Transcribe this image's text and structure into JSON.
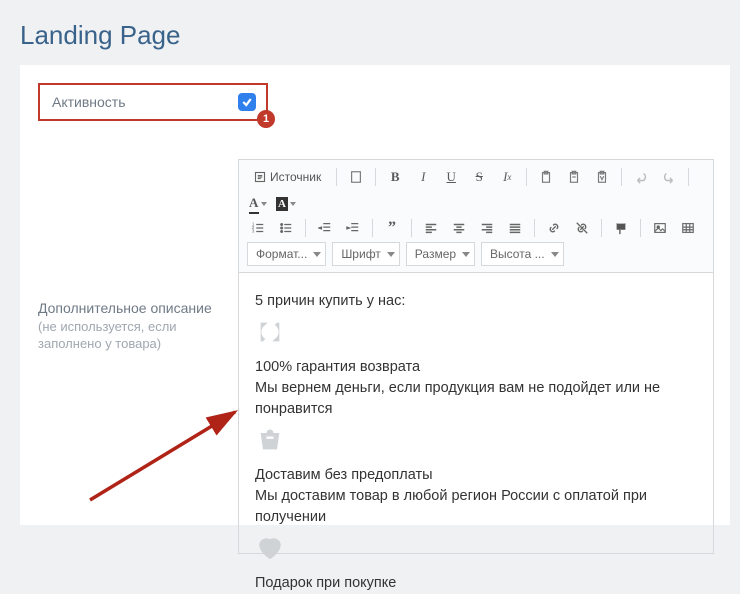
{
  "page_title": "Landing Page",
  "activity": {
    "label": "Активность",
    "checked": true,
    "badge": "1"
  },
  "description_field": {
    "label": "Дополнительное описание",
    "hint": "(не используется, если заполнено у товара)"
  },
  "toolbar": {
    "source": "Источник",
    "format": "Формат...",
    "font": "Шрифт",
    "size": "Размер",
    "lineheight": "Высота ..."
  },
  "content": {
    "heading": "5 причин купить у нас:",
    "block1_title": "100% гарантия возврата",
    "block1_text": "Мы вернем деньги, если продукция вам не подойдет или не понравится",
    "block2_title": "Доставим без предоплаты",
    "block2_text": "Мы доставим товар в любой регион России с оплатой при получении",
    "block3_title": "Подарок при покупке"
  }
}
